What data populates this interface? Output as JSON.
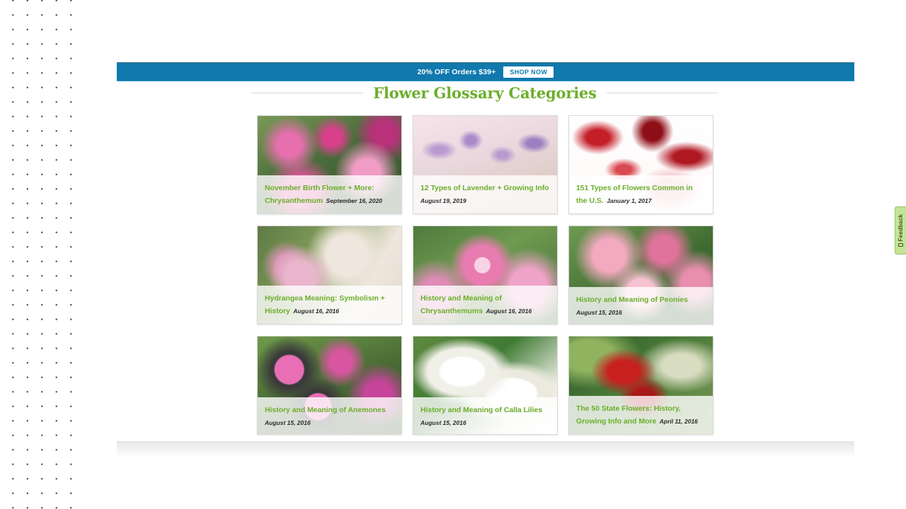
{
  "promo": {
    "text": "20% OFF Orders $39+",
    "shop_now_label": "SHOP NOW",
    "background_color": "#1179ae"
  },
  "section": {
    "title": "Flower Glossary Categories",
    "title_color": "#6cae2c"
  },
  "cards": [
    {
      "title": "November Birth Flower + More: Chrysanthemum",
      "date": "September 16, 2020",
      "image_name": "pink-chrysanthemum-blooms",
      "image_colors": [
        "#e0559a",
        "#c9357f",
        "#4a6b3a",
        "#8fae6a"
      ]
    },
    {
      "title": "12 Types of Lavender + Growing Info",
      "date": "August 19, 2019",
      "image_name": "lavender-field-stems",
      "image_colors": [
        "#f2dfe6",
        "#c9a9d6",
        "#9b7fc0",
        "#d8c6b4"
      ]
    },
    {
      "title": "151 Types of Flowers Common in the U.S.",
      "date": "January 1, 2017",
      "image_name": "red-rose-petals-on-white",
      "image_colors": [
        "#ffffff",
        "#c41f28",
        "#8f0f18",
        "#f2b8bc"
      ]
    },
    {
      "title": "Hydrangea Meaning: Symbolism + History",
      "date": "August 16, 2016",
      "image_name": "woman-holding-hydrangea-bouquet",
      "image_colors": [
        "#5f7a45",
        "#e8a9c4",
        "#efe6dd",
        "#b9cfa0"
      ]
    },
    {
      "title": "History and Meaning of Chrysanthemums",
      "date": "August 16, 2016",
      "image_name": "pink-chrysanthemum-closeup",
      "image_colors": [
        "#f0a3c8",
        "#d4649f",
        "#4f7a3d",
        "#f7d4e4"
      ]
    },
    {
      "title": "History and Meaning of Peonies",
      "date": "August 15, 2016",
      "image_name": "pink-peony-flowers",
      "image_colors": [
        "#f3a9c0",
        "#e0739b",
        "#3f6b32",
        "#8fb867"
      ]
    },
    {
      "title": "History and Meaning of Anemones",
      "date": "August 15, 2016",
      "image_name": "pink-anemone-flowers",
      "image_colors": [
        "#e86fb5",
        "#c6459a",
        "#3a3a3a",
        "#6f9a4a"
      ]
    },
    {
      "title": "History and Meaning of Calla Lilies",
      "date": "August 15, 2016",
      "image_name": "white-calla-lilies",
      "image_colors": [
        "#ffffff",
        "#f0efe8",
        "#e8c34a",
        "#3f7a33"
      ]
    },
    {
      "title": "The 50 State Flowers: History, Growing Info and More",
      "date": "April 11, 2016",
      "image_name": "garden-with-red-flowers",
      "image_colors": [
        "#2f5a2a",
        "#c81f1f",
        "#8fb35f",
        "#d8dcc0"
      ]
    }
  ],
  "feedback": {
    "label": "Feedback"
  }
}
